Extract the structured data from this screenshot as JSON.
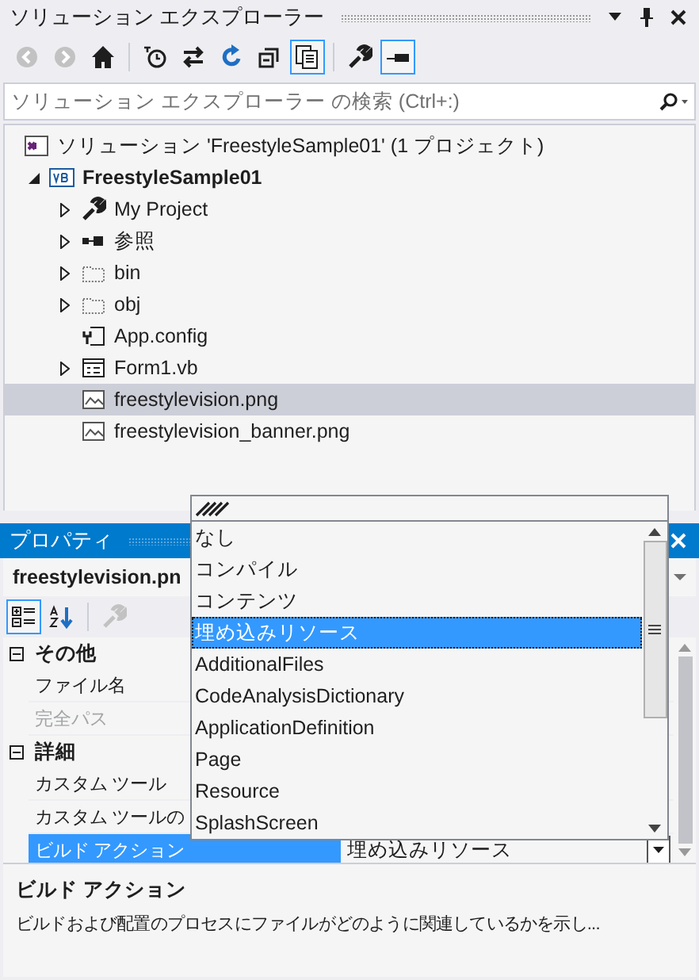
{
  "solution_explorer": {
    "title": "ソリューション エクスプローラー",
    "toolbar": [
      {
        "kind": "back",
        "disabled": true,
        "selected": false
      },
      {
        "kind": "forward",
        "disabled": true,
        "selected": false
      },
      {
        "kind": "home",
        "disabled": false,
        "selected": false
      },
      {
        "kind": "separator"
      },
      {
        "kind": "pending-changes",
        "disabled": false,
        "selected": false
      },
      {
        "kind": "sync",
        "disabled": false,
        "selected": false
      },
      {
        "kind": "refresh",
        "disabled": false,
        "selected": false
      },
      {
        "kind": "collapse",
        "disabled": false,
        "selected": false
      },
      {
        "kind": "show-all",
        "disabled": false,
        "selected": true
      },
      {
        "kind": "separator"
      },
      {
        "kind": "properties",
        "disabled": false,
        "selected": false
      },
      {
        "kind": "preview",
        "disabled": false,
        "selected": true
      }
    ],
    "search": {
      "placeholder": "ソリューション エクスプローラー の検索 (Ctrl+:)"
    },
    "tree": [
      {
        "label": "ソリューション 'FreestyleSample01' (1 プロジェクト)",
        "kind": "solution",
        "selected": false,
        "children": [
          {
            "label": "FreestyleSample01",
            "kind": "vb-project",
            "expanded": true,
            "selected": false,
            "children": [
              {
                "label": "My Project",
                "kind": "wrench",
                "expanded": false,
                "selected": false
              },
              {
                "label": "参照",
                "kind": "references",
                "expanded": false,
                "selected": false
              },
              {
                "label": "bin",
                "kind": "folder",
                "expanded": false,
                "selected": false
              },
              {
                "label": "obj",
                "kind": "folder",
                "expanded": false,
                "selected": false
              },
              {
                "label": "App.config",
                "kind": "config",
                "selected": false
              },
              {
                "label": "Form1.vb",
                "kind": "form",
                "expanded": false,
                "selected": false
              },
              {
                "label": "freestylevision.png",
                "kind": "image",
                "selected": true
              },
              {
                "label": "freestylevision_banner.png",
                "kind": "image",
                "selected": false
              }
            ]
          }
        ]
      }
    ]
  },
  "properties": {
    "title": "プロパティ",
    "object": "freestylevision.pn",
    "toolbar": [
      {
        "kind": "categorized",
        "selected": true,
        "disabled": false
      },
      {
        "kind": "alphabetical",
        "selected": false,
        "disabled": false
      },
      {
        "kind": "property-pages",
        "selected": false,
        "disabled": true
      }
    ],
    "categories": [
      {
        "name": "その他",
        "expanded": true,
        "rows": [
          {
            "name": "ファイル名",
            "disabled": false,
            "selected": false
          },
          {
            "name": "完全パス",
            "disabled": true,
            "selected": false
          }
        ]
      },
      {
        "name": "詳細",
        "expanded": true,
        "rows": [
          {
            "name": "カスタム ツール",
            "disabled": false,
            "selected": false
          },
          {
            "name": "カスタム ツールの",
            "disabled": false,
            "selected": false
          },
          {
            "name": "ビルド アクション",
            "value": "埋め込みリソース",
            "disabled": false,
            "selected": true
          }
        ]
      }
    ],
    "description": {
      "title": "ビルド アクション",
      "text": "ビルドおよび配置のプロセスにファイルがどのように関連しているかを示し..."
    }
  },
  "dropdown": {
    "items": [
      {
        "label": "なし",
        "selected": false
      },
      {
        "label": "コンパイル",
        "selected": false
      },
      {
        "label": "コンテンツ",
        "selected": false
      },
      {
        "label": "埋め込みリソース",
        "selected": true
      },
      {
        "label": "AdditionalFiles",
        "selected": false
      },
      {
        "label": "CodeAnalysisDictionary",
        "selected": false
      },
      {
        "label": "ApplicationDefinition",
        "selected": false
      },
      {
        "label": "Page",
        "selected": false
      },
      {
        "label": "Resource",
        "selected": false
      },
      {
        "label": "SplashScreen",
        "selected": false
      }
    ]
  }
}
